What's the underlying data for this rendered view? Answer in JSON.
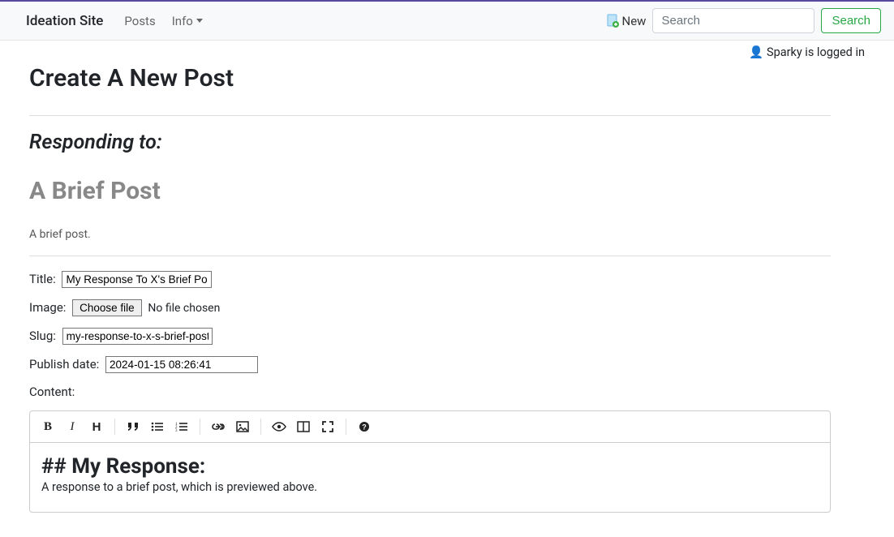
{
  "nav": {
    "brand": "Ideation Site",
    "posts": "Posts",
    "info": "Info",
    "new": "New",
    "search_placeholder": "Search",
    "search_button": "Search"
  },
  "auth": {
    "status": "Sparky is logged in"
  },
  "page": {
    "title": "Create A New Post"
  },
  "responding": {
    "label": "Responding to:",
    "post_title": "A Brief Post",
    "excerpt": "A brief post."
  },
  "form": {
    "title_label": "Title:",
    "title_value": "My Response To X's Brief Post",
    "image_label": "Image:",
    "choose_file": "Choose file",
    "file_status": "No file chosen",
    "slug_label": "Slug:",
    "slug_value": "my-response-to-x-s-brief-post",
    "publish_label": "Publish date:",
    "publish_value": "2024-01-15 08:26:41",
    "content_label": "Content:"
  },
  "editor": {
    "heading_line": "## My Response:",
    "body_line": "A response to a brief post, which is previewed above."
  }
}
